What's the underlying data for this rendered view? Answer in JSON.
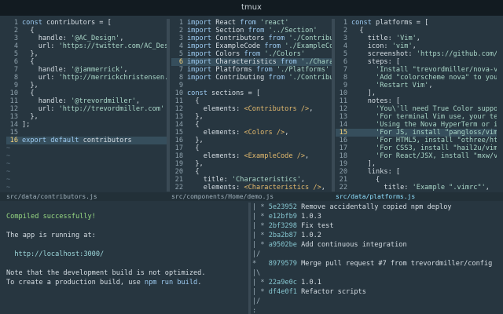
{
  "window": {
    "title": "tmux"
  },
  "pane1": {
    "lines": [
      "const contributors = [",
      "  {",
      "    handle: '@AC_Design',",
      "    url: 'https://twitter.com/AC_Design'",
      "  },",
      "  {",
      "    handle: '@jammerrick',",
      "    url: 'http://merrickchristensen.com/'",
      "  },",
      "  {",
      "    handle: '@trevordmiller',",
      "    url: 'http://trevordmiller.com'",
      "  },",
      "];",
      "",
      "export default contributors"
    ],
    "status": "src/data/contributors.js"
  },
  "pane2": {
    "lines": [
      "import React from 'react'",
      "import Section from '../Section'",
      "import Contributors from './Contributors'",
      "import ExampleCode from './ExampleCode'",
      "import Colors from './Colors'",
      "import Characteristics from './Characteri",
      "import Platforms from './Platforms'",
      "import Contributing from './Contributing'",
      "",
      "const sections = [",
      "  {",
      "    elements: <Contributors />,",
      "  },",
      "  {",
      "    elements: <Colors />,",
      "  },",
      "  {",
      "    elements: <ExampleCode />,",
      "  },",
      "  {",
      "    title: 'Characteristics',",
      "    elements: <Characteristics />,",
      "  },",
      "  {"
    ],
    "status": "src/components/Home/demo.js"
  },
  "pane3": {
    "lines": [
      "const platforms = [",
      "  {",
      "    title: 'Vim',",
      "    icon: 'vim',",
      "    screenshot: 'https://github.com/trevo",
      "    steps: [",
      "      'Install \"trevordmiller/nova-vim\" w",
      "      'Add \"colorscheme nova\" to your \".v",
      "      'Restart Vim',",
      "    ],",
      "    notes: [",
      "      'You\\'ll need True Color support (l",
      "      'For terminal Vim use, your termina",
      "      'Using the Nova HyperTerm or iTerm",
      "      'For JS, install \"pangloss/vim-java",
      "      'For HTML5, install \"othree/html5.v",
      "      'For CSS3, install \"hail2u/vim-css3",
      "      'For React/JSX, install \"mxw/vim-js",
      "    ],",
      "    links: [",
      "      {",
      "        title: 'Example \".vimrc\"',",
      "        url: 'https://github.com/trevordm",
      "      },"
    ],
    "status": "src/data/platforms.js"
  },
  "terminal1": {
    "success": "Compiled successfully!",
    "running": "The app is running at:",
    "url": "http://localhost:3000/",
    "note1": "Note that the development build is not optimized.",
    "note2_prefix": "To create a production build, use ",
    "note2_cmd": "npm run build",
    "note2_suffix": "."
  },
  "terminal2": {
    "lines": [
      {
        "graph": "| * ",
        "hash": "5e23952",
        "msg": "Remove accidentally copied npm deploy"
      },
      {
        "graph": "| * ",
        "hash": "e12bfb9",
        "msg": "1.0.3"
      },
      {
        "graph": "| * ",
        "hash": "2bf3298",
        "msg": "Fix test"
      },
      {
        "graph": "| * ",
        "hash": "2ba2b87",
        "msg": "1.0.2"
      },
      {
        "graph": "| * ",
        "hash": "a9502be",
        "msg": "Add continuous integration"
      },
      {
        "graph": "|/",
        "hash": "",
        "msg": ""
      },
      {
        "graph": "*   ",
        "hash": "8979579",
        "msg": "Merge pull request #7 from trevordmiller/config"
      },
      {
        "graph": "|\\",
        "hash": "",
        "msg": ""
      },
      {
        "graph": "| * ",
        "hash": "22a9e0c",
        "msg": "1.0.1"
      },
      {
        "graph": "| * ",
        "hash": "df4e0f1",
        "msg": "Refactor scripts"
      },
      {
        "graph": "|/",
        "hash": "",
        "msg": ""
      },
      {
        "graph": ":",
        "hash": "",
        "msg": ""
      }
    ]
  }
}
